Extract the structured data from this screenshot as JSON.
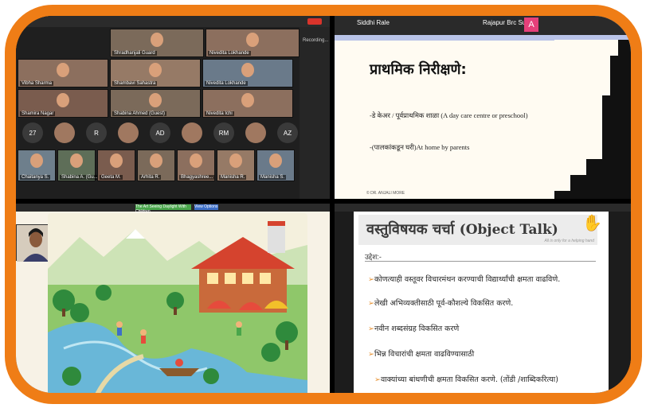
{
  "top_left": {
    "participants": [
      {
        "name": "Shradhanjali Guard"
      },
      {
        "name": "Nivedita Lokhande"
      },
      {
        "name": "Vibha Sharma"
      },
      {
        "name": "Shambavi Sahastra"
      },
      {
        "name": "Nivedita Lokhande"
      },
      {
        "name": "Shamira Nagar"
      },
      {
        "name": "Shabina Ahmed (Guest)"
      },
      {
        "name": "Nivedita Ichi"
      },
      {
        "name": "Chaitanya S."
      },
      {
        "name": "Shabina A. (Gu..."
      },
      {
        "name": "Geeta M."
      },
      {
        "name": "Arhita R."
      },
      {
        "name": "Bhagyashree..."
      },
      {
        "name": "Manisha R."
      },
      {
        "name": "Manisha S."
      }
    ],
    "chips": [
      "27",
      "R",
      "AD",
      "RM",
      "AZ"
    ],
    "side_label": "Recording...",
    "leave_label": "Leave"
  },
  "top_right": {
    "header_names": [
      "Siddhi Rale",
      "Rajapur Brc Su...",
      "A"
    ],
    "slide_title": "प्राथमिक निरीक्षणे:",
    "bullets": [
      "-डे केअर / पूर्वप्राथमिक शाळा (A day care centre or preschool)",
      "-(पालकांकडून घरी)At home by parents"
    ],
    "footer": "© DR. ANJALI MORE"
  },
  "bottom_left": {
    "tab_label": "The Art Seeing Daylight With Children",
    "tab2_label": "View Options"
  },
  "bottom_right": {
    "title_marathi": "वस्तुविषयक चर्चा",
    "title_english": "(Object Talk)",
    "objective_label": "उद्देश:-",
    "corner_note": "All is only for a helping hand",
    "bullets": [
      "कोणत्याही वस्तूवर विचारमंथन करण्याची विद्यार्थ्यांची क्षमता वाढविणे.",
      "लेखी अभिव्यक्तीसाठी पूर्व-कौशल्ये विकसित करणे.",
      "नवीन शब्दसंग्रह विकसित करणे",
      "भिन्न विचारांची क्षमता वाढविण्यासाठी",
      "वाक्यांच्या बांधणीची क्षमता विकसित करणे. (तोंडी /शाब्दिकरित्या)"
    ]
  },
  "colors": {
    "frame": "#ef7d16",
    "bullet_arrow": "#e79436",
    "hands": "#f07a1a"
  }
}
